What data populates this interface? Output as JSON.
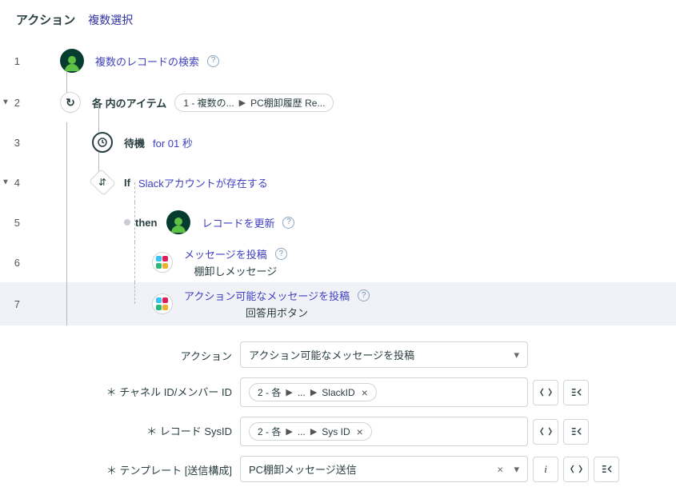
{
  "header": {
    "title": "アクション",
    "multi": "複数選択"
  },
  "rows": {
    "r1": {
      "num": "1",
      "label": "複数のレコードの検索"
    },
    "r2": {
      "num": "2",
      "label": "各 内のアイテム",
      "pill": {
        "a": "1 - 複数の...",
        "b": "PC棚卸履歴 Re..."
      }
    },
    "r3": {
      "num": "3",
      "keyword": "待機",
      "detail": "for 01 秒"
    },
    "r4": {
      "num": "4",
      "keyword": "If",
      "detail": "Slackアカウントが存在する"
    },
    "r5": {
      "num": "5",
      "keyword": "then",
      "label": "レコードを更新"
    },
    "r6": {
      "num": "6",
      "label": "メッセージを投稿",
      "sub": "棚卸しメッセージ"
    },
    "r7": {
      "num": "7",
      "label": "アクション可能なメッセージを投稿",
      "sub": "回答用ボタン"
    }
  },
  "form": {
    "action": {
      "label": "アクション",
      "value": "アクション可能なメッセージを投稿"
    },
    "channel": {
      "label": "＊ チャネル ID/メンバー ID",
      "pill": {
        "a": "2 - 各",
        "b": "...",
        "c": "SlackID"
      }
    },
    "sysid": {
      "label": "＊ レコード SysID",
      "pill": {
        "a": "2 - 各",
        "b": "...",
        "c": "Sys ID"
      }
    },
    "template": {
      "label": "＊ テンプレート [送信構成]",
      "value": "PC棚卸メッセージ送信"
    }
  }
}
